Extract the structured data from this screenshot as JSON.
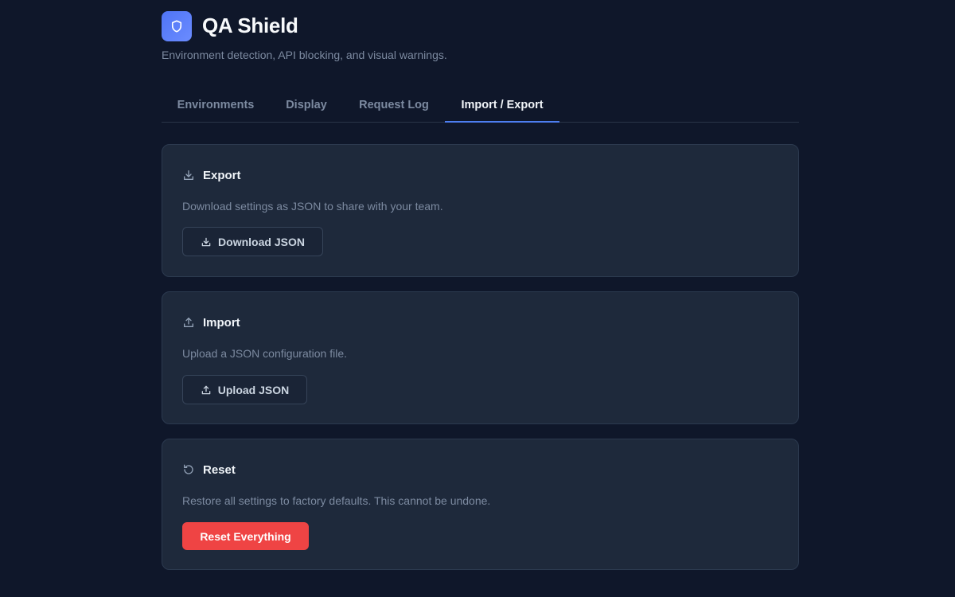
{
  "app": {
    "title": "QA Shield",
    "subtitle": "Environment detection, API blocking, and visual warnings.",
    "logo_icon": "shield-icon",
    "accent_color": "#5b7ff7"
  },
  "tabs": [
    {
      "label": "Environments",
      "active": false
    },
    {
      "label": "Display",
      "active": false
    },
    {
      "label": "Request Log",
      "active": false
    },
    {
      "label": "Import / Export",
      "active": true
    }
  ],
  "export": {
    "title": "Export",
    "icon": "download-icon",
    "description": "Download settings as JSON to share with your team.",
    "button_label": "Download JSON"
  },
  "import": {
    "title": "Import",
    "icon": "upload-icon",
    "description": "Upload a JSON configuration file.",
    "button_label": "Upload JSON"
  },
  "reset": {
    "title": "Reset",
    "icon": "reset-icon",
    "description": "Restore all settings to factory defaults. This cannot be undone.",
    "button_label": "Reset Everything",
    "button_color": "#ef4444"
  }
}
